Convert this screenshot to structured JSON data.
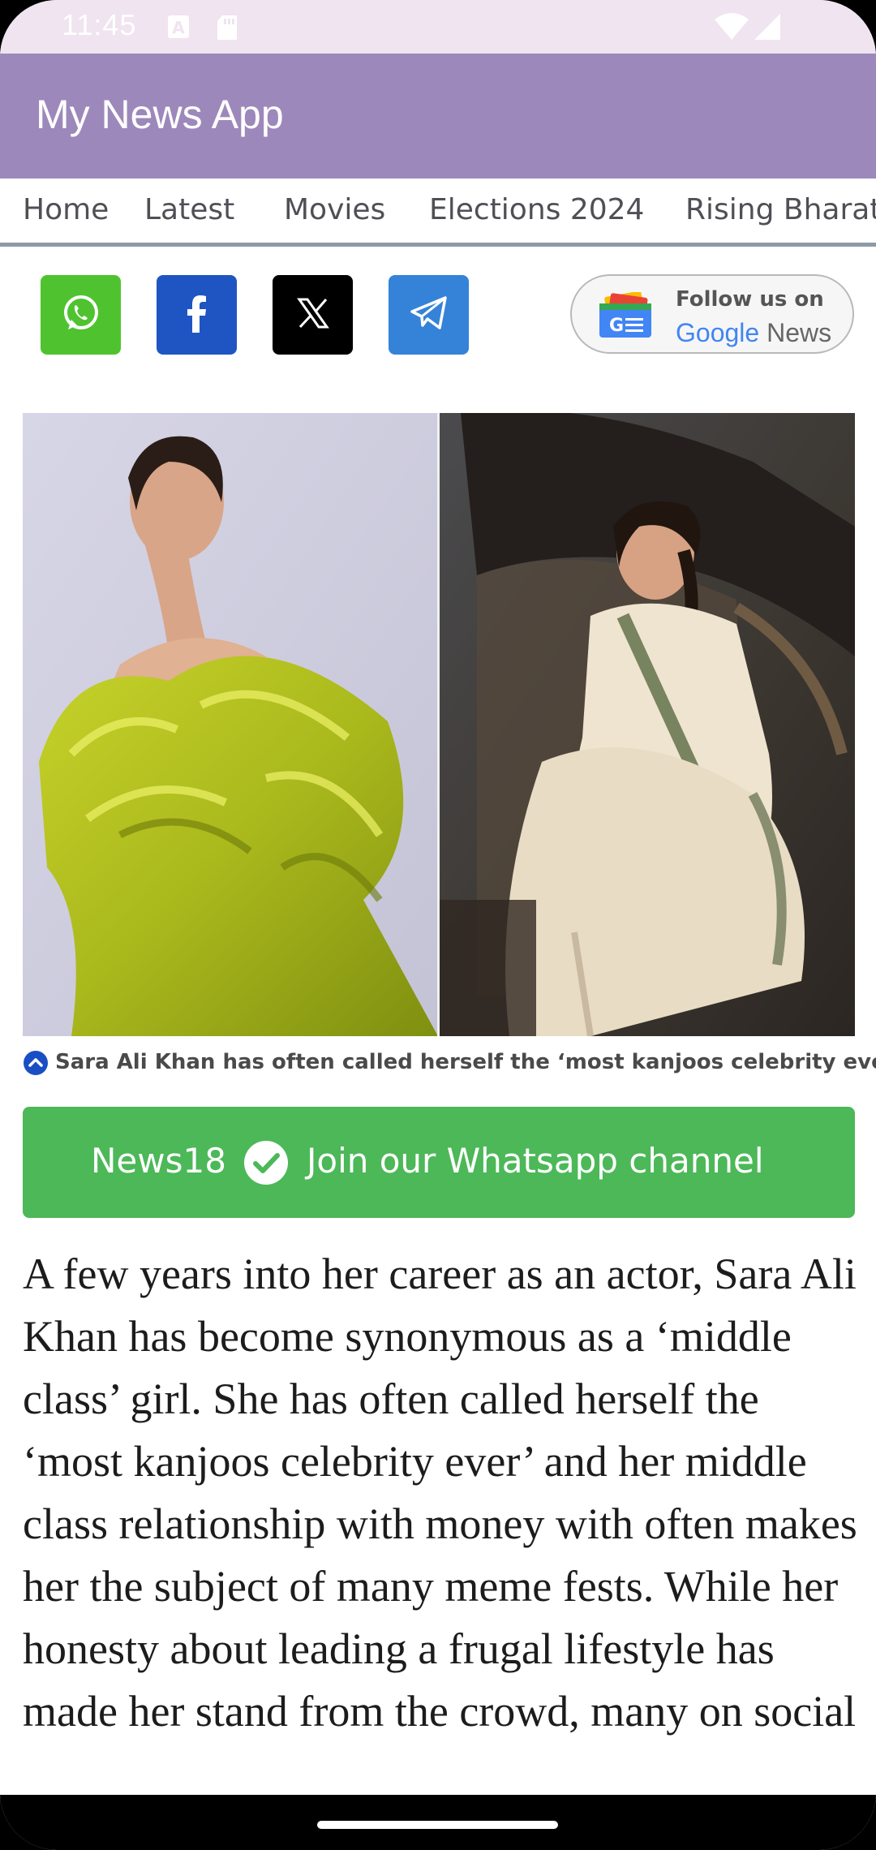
{
  "status_bar": {
    "time": "11:45",
    "icons": [
      "keyboard-a-icon",
      "sd-card-icon",
      "wifi-icon",
      "signal-icon"
    ]
  },
  "app_bar": {
    "title": "My News App",
    "color": "#9d88bb"
  },
  "tabs": [
    {
      "label": "Home"
    },
    {
      "label": "Latest"
    },
    {
      "label": "Movies"
    },
    {
      "label": "Elections 2024"
    },
    {
      "label": "Rising Bharat"
    }
  ],
  "share": {
    "buttons": [
      {
        "name": "whatsapp",
        "icon": "whatsapp-icon",
        "color": "#4fc32f"
      },
      {
        "name": "facebook",
        "icon": "facebook-icon",
        "color": "#1e55c2"
      },
      {
        "name": "x",
        "icon": "x-icon",
        "color": "#000000"
      },
      {
        "name": "telegram",
        "icon": "telegram-icon",
        "color": "#3583d8"
      }
    ],
    "google_news": {
      "line1": "Follow us on",
      "line2_google": "Google",
      "line2_news": "News"
    }
  },
  "hero": {
    "caption": "Sara Ali Khan has often called herself the ‘most kanjoos celebrity ever’."
  },
  "whatsapp_banner": {
    "brand": "News18",
    "text": "Join our Whatsapp channel",
    "color": "#4cb858"
  },
  "article": {
    "body": "A few years into her career as an actor, Sara Ali Khan has become synonymous as a ‘middle class’ girl. She has often called herself the ‘most kanjoos celebrity ever’ and her middle class relationship with money with often makes her the subject of many meme fests. While her honesty about leading a frugal lifestyle has made her stand from the crowd, many on social"
  }
}
